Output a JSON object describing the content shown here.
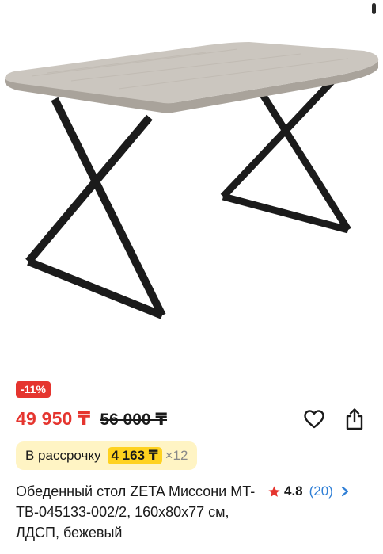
{
  "product": {
    "discount": "-11%",
    "price": "49 950 ₸",
    "old_price": "56 000 ₸",
    "installment": {
      "label": "В рассрочку",
      "amount": "4 163 ₸",
      "term": "×12"
    },
    "title": "Обеденный стол ZETA Миссони MT-TB-045133-002/2, 160x80x77 см, ЛДСП, бежевый",
    "rating": {
      "value": "4.8",
      "count": "(20)"
    }
  },
  "icons": {
    "wishlist": "heart-icon",
    "share": "share-icon",
    "rating": "star-icon",
    "more": "chevron-right-icon"
  },
  "colors": {
    "accent_red": "#e5352f",
    "installment_bg": "#fff4c4",
    "installment_highlight": "#ffd21f",
    "link_blue": "#2f7fd6"
  }
}
